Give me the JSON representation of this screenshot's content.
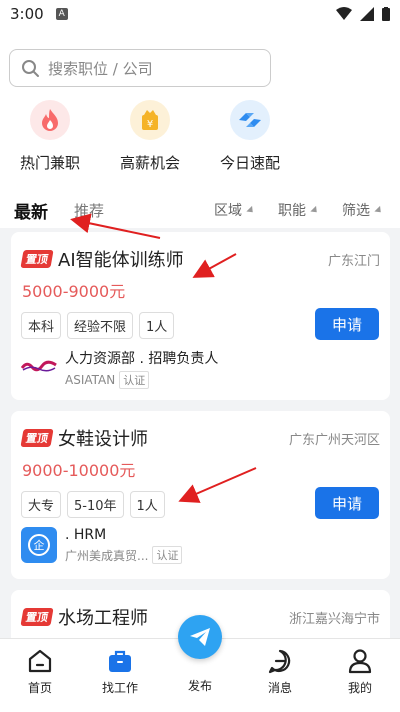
{
  "status": {
    "time": "3:00",
    "app_icon": "A"
  },
  "search": {
    "placeholder": "搜索职位 / 公司"
  },
  "quick_actions": [
    {
      "label": "热门兼职",
      "icon": "flame-icon",
      "color": "#f86b6b"
    },
    {
      "label": "高薪机会",
      "icon": "money-bag-icon",
      "color": "#f5b328"
    },
    {
      "label": "今日速配",
      "icon": "match-icon",
      "color": "#2f8cf0"
    }
  ],
  "tabs": {
    "latest": "最新",
    "recommend": "推荐"
  },
  "filters": [
    "区域",
    "职能",
    "筛选"
  ],
  "jobs": [
    {
      "pin": "置顶",
      "title": "AI智能体训练师",
      "location": "广东江门",
      "salary": "5000-9000元",
      "tags": [
        "本科",
        "经验不限",
        "1人"
      ],
      "apply": "申请",
      "company_role": "人力资源部 . 招聘负责人",
      "company_name": "ASIATAN",
      "cert": "认证"
    },
    {
      "pin": "置顶",
      "title": "女鞋设计师",
      "location": "广东广州天河区",
      "salary": "9000-10000元",
      "tags": [
        "大专",
        "5-10年",
        "1人"
      ],
      "apply": "申请",
      "company_role": ". HRM",
      "company_name": "广州美成真贸...",
      "cert": "认证"
    },
    {
      "pin": "置顶",
      "title": "水场工程师",
      "location": "浙江嘉兴海宁市"
    }
  ],
  "nav": {
    "home": "首页",
    "jobs": "找工作",
    "publish": "发布",
    "messages": "消息",
    "mine": "我的"
  },
  "colors": {
    "accent": "#1a73e8",
    "salary": "#e55a5a",
    "pin": "#e53935",
    "annotation": "#e02020"
  }
}
